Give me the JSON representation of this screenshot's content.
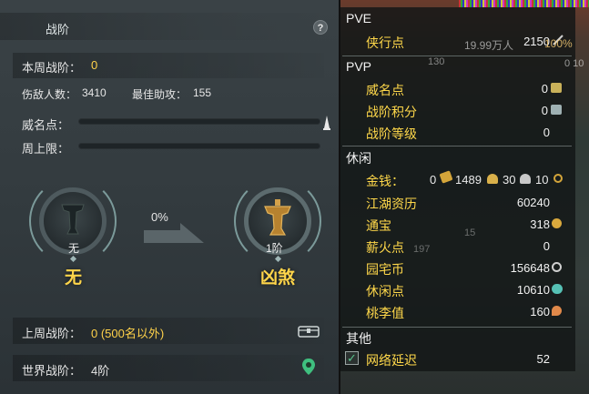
{
  "left": {
    "title": "战阶",
    "help_label": "?",
    "weekly_rank_label": "本周战阶：",
    "weekly_rank_value": "0",
    "kills_label": "伤敌人数：",
    "kills_value": "3410",
    "best_assist_label": "最佳助攻：",
    "best_assist_value": "155",
    "prestige_label": "威名点：",
    "weekly_cap_label": "周上限：",
    "progress_percent": "0%",
    "current_rank_small": "无",
    "current_rank_big": "无",
    "next_rank_small": "1阶",
    "next_rank_big": "凶煞",
    "last_rank_label": "上周战阶：",
    "last_rank_value": "0 (500名以外)",
    "world_rank_label": "世界战阶：",
    "world_rank_value": "4阶"
  },
  "right": {
    "overlay_number": "19.99万人",
    "overlay_percent": "100%",
    "overlay_130": "130",
    "overlay_0_10": "0 10",
    "overlay_197": "197",
    "overlay_15": "15",
    "pve_title": "PVE",
    "pve": [
      {
        "label": "侠行点",
        "value": "2150"
      }
    ],
    "pvp_title": "PVP",
    "pvp": [
      {
        "label": "威名点",
        "value": "0"
      },
      {
        "label": "战阶积分",
        "value": "0"
      },
      {
        "label": "战阶等级",
        "value": "0"
      }
    ],
    "leisure_title": "休闲",
    "money_label": "金钱：",
    "money_values": [
      "0",
      "1489",
      "30",
      "10"
    ],
    "leisure": [
      {
        "label": "江湖资历",
        "value": "60240"
      },
      {
        "label": "通宝",
        "value": "318"
      },
      {
        "label": "薪火点",
        "value": "0"
      },
      {
        "label": "园宅币",
        "value": "156648"
      },
      {
        "label": "休闲点",
        "value": "10610"
      },
      {
        "label": "桃李值",
        "value": "160"
      }
    ],
    "other_title": "其他",
    "latency_label": "网络延迟",
    "latency_value": "52"
  },
  "colors": {
    "accent_yellow": "#ffd54a",
    "panel_bg": "#333b3f",
    "green_check": "#59c28c"
  }
}
